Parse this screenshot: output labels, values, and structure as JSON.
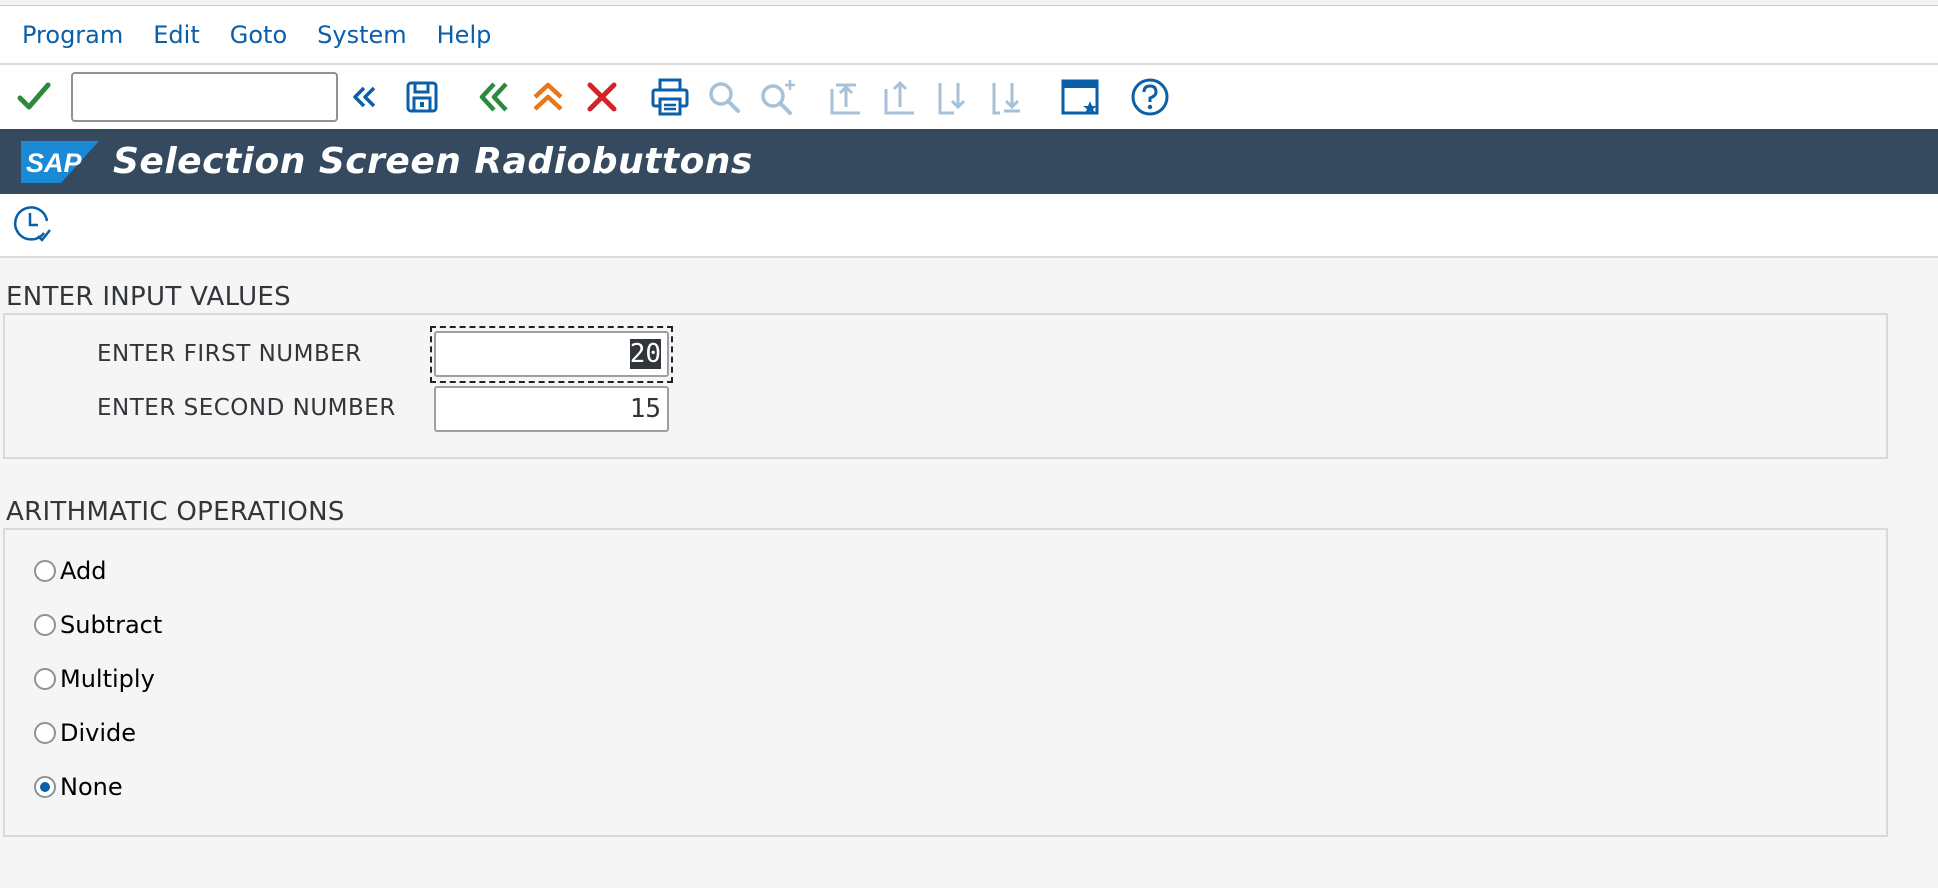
{
  "menu": [
    "Program",
    "Edit",
    "Goto",
    "System",
    "Help"
  ],
  "toolbar": {
    "command_field_value": "",
    "icons": [
      "check-icon",
      "collapse-left-icon",
      "save-icon",
      "back-icon",
      "exit-icon",
      "cancel-icon",
      "print-icon",
      "find-icon",
      "find-next-icon",
      "first-page-icon",
      "previous-page-icon",
      "next-page-icon",
      "last-page-icon",
      "create-shortcut-icon",
      "help-icon"
    ],
    "colors": {
      "check": "#2b8a3e",
      "back": "#2b8a3e",
      "exit": "#e8771a",
      "cancel": "#d3222a",
      "blue": "#0a5fa8",
      "disabled": "#a7c1d9"
    }
  },
  "title": "Selection Screen Radiobuttons",
  "app_toolbar": {
    "icons": [
      "execute-clock-icon"
    ]
  },
  "input_section": {
    "title": "ENTER INPUT VALUES",
    "fields": [
      {
        "label": "ENTER FIRST NUMBER",
        "value": "20",
        "focused": true
      },
      {
        "label": "ENTER SECOND NUMBER",
        "value": "15",
        "focused": false
      }
    ]
  },
  "operations_section": {
    "title": "ARITHMATIC OPERATIONS",
    "options": [
      {
        "label": "Add",
        "checked": false
      },
      {
        "label": "Subtract",
        "checked": false
      },
      {
        "label": "Multiply",
        "checked": false
      },
      {
        "label": "Divide",
        "checked": false
      },
      {
        "label": "None",
        "checked": true
      }
    ]
  },
  "colors": {
    "title_bar": "#354a5f",
    "link_blue": "#0a5fa8",
    "background": "#f5f5f5"
  }
}
